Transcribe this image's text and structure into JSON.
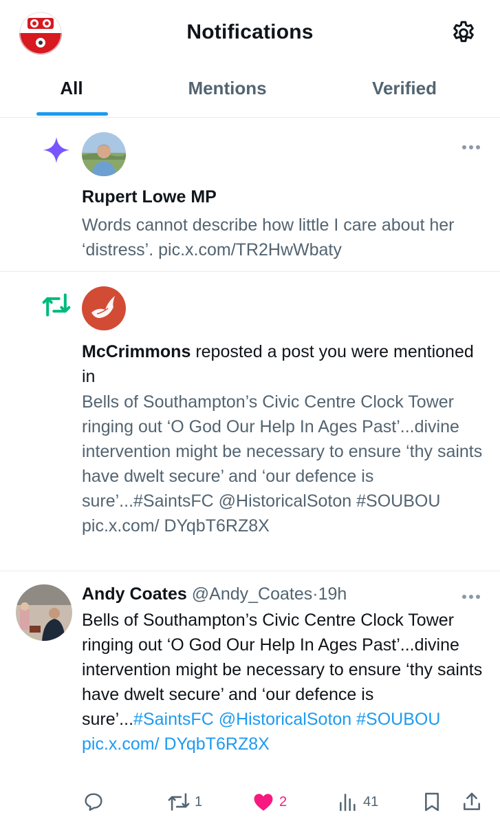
{
  "header": {
    "title": "Notifications",
    "avatar_icon": "saints-crest-icon",
    "settings_icon": "gear-icon"
  },
  "tabs": [
    {
      "label": "All",
      "active": true
    },
    {
      "label": "Mentions",
      "active": false
    },
    {
      "label": "Verified",
      "active": false
    }
  ],
  "notifications": [
    {
      "type": "recommended-post",
      "icon": "sparkle-icon",
      "author": "Rupert Lowe MP",
      "text": "Words cannot describe how little I care about her ‘distress’. pic.x.com/TR2HwWbaty"
    },
    {
      "type": "repost",
      "icon": "repost-icon",
      "author": "McCrimmons",
      "action": "reposted a post you were mentioned in",
      "text": "Bells of Southampton’s Civic Centre Clock Tower ringing out ‘O God Our Help In Ages Past’...divine intervention might be necessary to ensure ‘thy saints have dwelt secure’ and ‘our defence is sure’...#SaintsFC @HistoricalSoton #SOUBOU pic.x.com/ DYqbT6RZ8X"
    },
    {
      "type": "mention",
      "author": "Andy Coates",
      "handle": "@Andy_Coates",
      "time": "19h",
      "text_plain": "Bells of Southampton’s Civic Centre Clock Tower ringing out ‘O God Our Help In Ages Past’...divine intervention might be necessary to ensure ‘thy saints have dwelt secure’ and ‘our defence is sure’...",
      "text_links": "#SaintsFC @HistoricalSoton #SOUBOU pic.x.com/ DYqbT6RZ8X",
      "stats": {
        "replies": "",
        "reposts": "1",
        "likes": "2",
        "views": "41"
      }
    }
  ],
  "colors": {
    "accent": "#1d9bf0",
    "like": "#f91880",
    "repost": "#00ba7c",
    "sparkle": "#7856ff",
    "secondary_text": "#536471"
  }
}
